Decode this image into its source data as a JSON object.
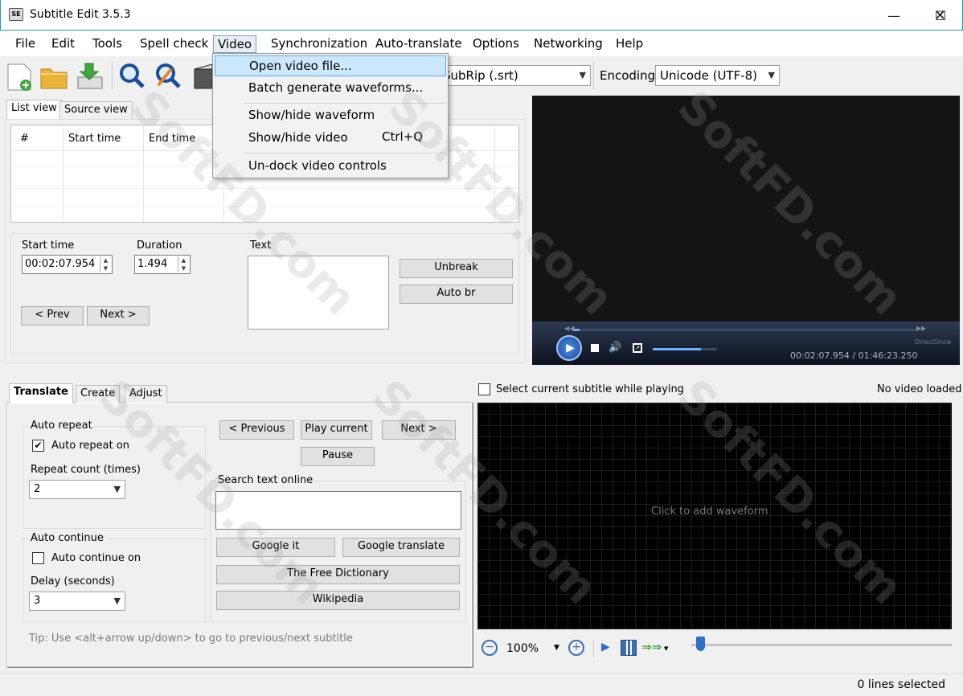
{
  "window": {
    "title": "Subtitle Edit 3.5.3",
    "app_icon_text": "SE"
  },
  "menu": [
    "File",
    "Edit",
    "Tools",
    "Spell check",
    "Video",
    "Synchronization",
    "Auto-translate",
    "Options",
    "Networking",
    "Help"
  ],
  "toolbar": {
    "format_value": "SubRip (.srt)",
    "encoding_label": "Encoding",
    "encoding_value": "Unicode (UTF-8)"
  },
  "video_menu": {
    "items": [
      "Open video file...",
      "Batch generate waveforms...",
      "Show/hide waveform",
      "Show/hide video",
      "Un-dock video controls"
    ],
    "shortcut_show_hide_video": "Ctrl+Q"
  },
  "list_tabs": [
    "List view",
    "Source view"
  ],
  "list_columns": [
    "#",
    "Start time",
    "End time"
  ],
  "editor": {
    "start_time_label": "Start time",
    "start_time_value": "00:02:07.954",
    "duration_label": "Duration",
    "duration_value": "1.494",
    "text_label": "Text",
    "unbreak": "Unbreak",
    "auto_br": "Auto br",
    "prev": "< Prev",
    "next": "Next >"
  },
  "player": {
    "engine": "DirectShow",
    "time": "00:02:07.954 / 01:46:23.250",
    "progress": 0.02,
    "volume": 0.75
  },
  "bottom_tabs": [
    "Translate",
    "Create",
    "Adjust"
  ],
  "translate": {
    "auto_repeat_group": "Auto repeat",
    "auto_repeat_on": "Auto repeat on",
    "auto_repeat_checked": true,
    "repeat_count_label": "Repeat count (times)",
    "repeat_count_value": "2",
    "auto_continue_group": "Auto continue",
    "auto_continue_on": "Auto continue on",
    "auto_continue_checked": false,
    "delay_label": "Delay (seconds)",
    "delay_value": "3",
    "previous": "< Previous",
    "play_current": "Play current",
    "next": "Next >",
    "pause": "Pause",
    "search_group": "Search text online",
    "google_it": "Google it",
    "google_translate": "Google translate",
    "free_dictionary": "The Free Dictionary",
    "wikipedia": "Wikipedia",
    "tip": "Tip: Use <alt+arrow up/down> to go to previous/next subtitle"
  },
  "waveform": {
    "select_current": "Select current subtitle while playing",
    "status": "No video loaded",
    "placeholder": "Click to add waveform",
    "zoom": "100%",
    "position": 0.02
  },
  "statusbar": {
    "lines_selected": "0 lines selected"
  },
  "watermark": "SoftFD.com",
  "colors": {
    "accent": "#1aa1a8",
    "highlight": "#cce8ff",
    "video_bg": "#141414"
  }
}
